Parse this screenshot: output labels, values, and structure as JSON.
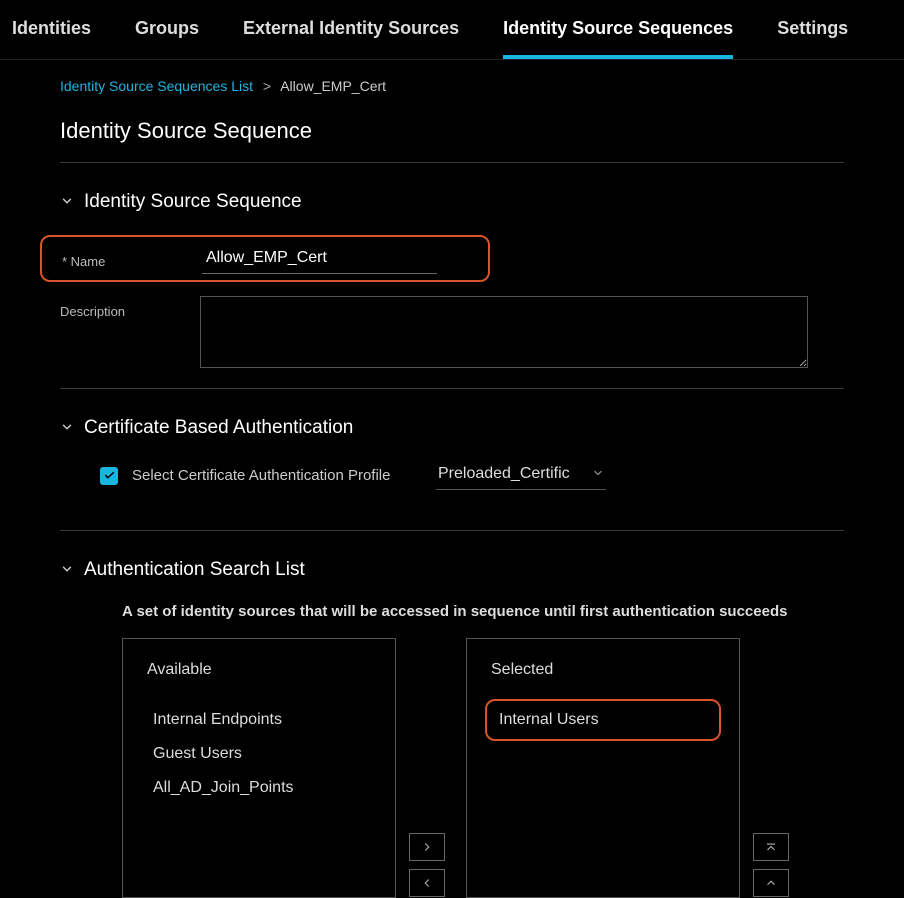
{
  "tabs": [
    {
      "label": "Identities",
      "active": false
    },
    {
      "label": "Groups",
      "active": false
    },
    {
      "label": "External Identity Sources",
      "active": false
    },
    {
      "label": "Identity Source Sequences",
      "active": true
    },
    {
      "label": "Settings",
      "active": false
    }
  ],
  "breadcrumb": {
    "link": "Identity Source Sequences List",
    "current": "Allow_EMP_Cert"
  },
  "page_title": "Identity Source Sequence",
  "sections": {
    "iss": {
      "title": "Identity Source Sequence",
      "name_label": "* Name",
      "name_value": "Allow_EMP_Cert",
      "desc_label": "Description",
      "desc_value": ""
    },
    "cert": {
      "title": "Certificate Based Authentication",
      "checkbox_label": "Select Certificate Authentication Profile",
      "checkbox_checked": true,
      "select_value": "Preloaded_Certific"
    },
    "auth": {
      "title": "Authentication Search List",
      "description": "A set of identity sources that will be accessed in sequence until first authentication succeeds",
      "available_title": "Available",
      "available": [
        "Internal Endpoints",
        "Guest Users",
        "All_AD_Join_Points"
      ],
      "selected_title": "Selected",
      "selected": [
        "Internal Users"
      ]
    }
  }
}
